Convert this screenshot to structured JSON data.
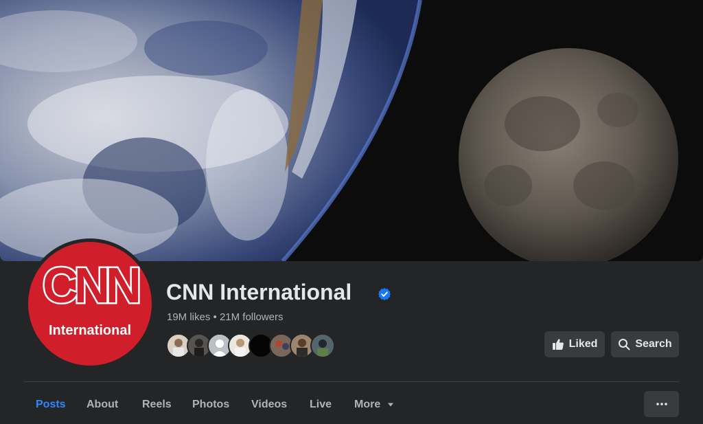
{
  "page": {
    "name": "CNN International",
    "stats": "19M likes • 21M followers",
    "verified": true
  },
  "avatar": {
    "logo_text": "CNN",
    "logo_subtext": "International"
  },
  "actions": {
    "liked_label": "Liked",
    "search_label": "Search"
  },
  "tabs": [
    {
      "label": "Posts",
      "active": true
    },
    {
      "label": "About",
      "active": false
    },
    {
      "label": "Reels",
      "active": false
    },
    {
      "label": "Photos",
      "active": false
    },
    {
      "label": "Videos",
      "active": false
    },
    {
      "label": "Live",
      "active": false
    },
    {
      "label": "More",
      "active": false
    }
  ],
  "icons": {
    "verified": "verified-badge-icon",
    "liked": "thumbs-up-icon",
    "search": "search-icon",
    "more_dropdown": "caret-down-icon",
    "overflow": "more-horizontal-icon"
  },
  "colors": {
    "background": "#242526",
    "button": "#3a3b3c",
    "accent": "#2d88ff",
    "text_primary": "#e4e6eb",
    "text_secondary": "#b0b3b8",
    "brand_red": "#d01f2b"
  }
}
